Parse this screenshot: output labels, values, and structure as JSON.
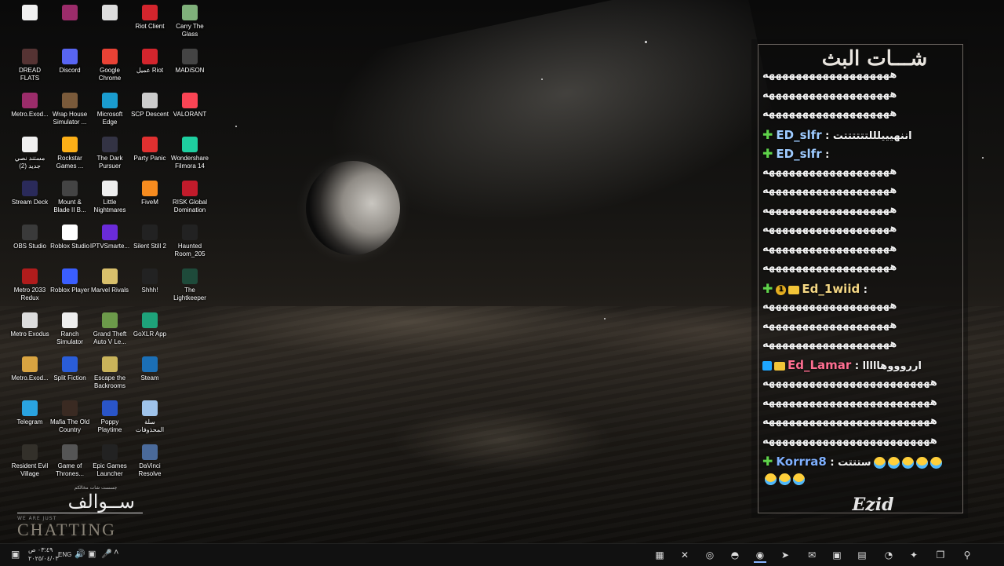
{
  "desktop_icons": [
    {
      "label": "",
      "icon": "text-file-icon",
      "color": "#f0f0f0"
    },
    {
      "label": "",
      "icon": "winrar-icon",
      "color": "#9b2c6a"
    },
    {
      "label": "",
      "icon": "cursor-app-icon",
      "color": "#dddddd"
    },
    {
      "label": "Riot Client",
      "icon": "riot-client-icon",
      "color": "#d3252d"
    },
    {
      "label": "Carry The Glass",
      "icon": "carry-glass-icon",
      "color": "#7fb07a"
    },
    {
      "label": "DREAD FLATS",
      "icon": "dread-flats-icon",
      "color": "#553333"
    },
    {
      "label": "Discord",
      "icon": "discord-icon",
      "color": "#5865f2"
    },
    {
      "label": "Google Chrome",
      "icon": "chrome-icon",
      "color": "#e94235"
    },
    {
      "label": "عميل Riot",
      "icon": "riot-client-icon",
      "color": "#d3252d"
    },
    {
      "label": "MADiSON",
      "icon": "madison-icon",
      "color": "#444444"
    },
    {
      "label": "Metro.Exod...",
      "icon": "winrar-icon",
      "color": "#9b2c6a"
    },
    {
      "label": "Wrap House Simulator ...",
      "icon": "wrap-house-icon",
      "color": "#7a5a3a"
    },
    {
      "label": "Microsoft Edge",
      "icon": "edge-icon",
      "color": "#1a9ccf"
    },
    {
      "label": "SCP Descent",
      "icon": "scp-icon",
      "color": "#cccccc"
    },
    {
      "label": "VALORANT",
      "icon": "valorant-icon",
      "color": "#fa4454"
    },
    {
      "label": "مستند نصي جديد (2)",
      "icon": "text-file-icon",
      "color": "#f0f0f0"
    },
    {
      "label": "Rockstar Games ...",
      "icon": "rockstar-icon",
      "color": "#fcaf17"
    },
    {
      "label": "The Dark Pursuer",
      "icon": "dark-pursuer-icon",
      "color": "#333344"
    },
    {
      "label": "Party Panic",
      "icon": "party-panic-icon",
      "color": "#e03030"
    },
    {
      "label": "Wondershare Filmora 14",
      "icon": "filmora-icon",
      "color": "#1ecfa0"
    },
    {
      "label": "Stream Deck",
      "icon": "stream-deck-icon",
      "color": "#2a2a5a"
    },
    {
      "label": "Mount & Blade II B...",
      "icon": "mount-blade-icon",
      "color": "#444444"
    },
    {
      "label": "Little Nightmares",
      "icon": "little-nightmares-icon",
      "color": "#eeeeee"
    },
    {
      "label": "FiveM",
      "icon": "fivem-icon",
      "color": "#f78c1f"
    },
    {
      "label": "RISK Global Domination",
      "icon": "risk-icon",
      "color": "#c21b2b"
    },
    {
      "label": "OBS Studio",
      "icon": "obs-icon",
      "color": "#3a3a3a"
    },
    {
      "label": "Roblox Studio",
      "icon": "roblox-studio-icon",
      "color": "#ffffff"
    },
    {
      "label": "IPTVSmarte...",
      "icon": "iptv-icon",
      "color": "#6a2bd9"
    },
    {
      "label": "Silent Still 2",
      "icon": "silent-still-icon",
      "color": "#222222"
    },
    {
      "label": "Haunted Room_205",
      "icon": "haunted-room-icon",
      "color": "#222222"
    },
    {
      "label": "Metro 2033 Redux",
      "icon": "metro-redux-icon",
      "color": "#b01c1c"
    },
    {
      "label": "Roblox Player",
      "icon": "roblox-player-icon",
      "color": "#3a5eff"
    },
    {
      "label": "Marvel Rivals",
      "icon": "marvel-rivals-icon",
      "color": "#d9c06b"
    },
    {
      "label": "Shhh!",
      "icon": "shhh-icon",
      "color": "#222222"
    },
    {
      "label": "The Lightkeeper",
      "icon": "lightkeeper-icon",
      "color": "#1e4a3a"
    },
    {
      "label": "Metro Exodus",
      "icon": "metro-exodus-icon",
      "color": "#dddddd"
    },
    {
      "label": "Ranch Simulator",
      "icon": "ranch-simulator-icon",
      "color": "#eeeeee"
    },
    {
      "label": "Grand Theft Auto V Le...",
      "icon": "gta-icon",
      "color": "#6c9a4a"
    },
    {
      "label": "GoXLR App",
      "icon": "goxlr-icon",
      "color": "#1ea37a"
    },
    {
      "label": "Metro.Exod...",
      "icon": "text-file-icon",
      "color": "#d9a441"
    },
    {
      "label": "Split Fiction",
      "icon": "split-fiction-icon",
      "color": "#2a5dd8"
    },
    {
      "label": "Escape the Backrooms",
      "icon": "backrooms-icon",
      "color": "#c9b35a"
    },
    {
      "label": "Steam",
      "icon": "steam-icon",
      "color": "#1b6fb6"
    },
    {
      "label": "Telegram",
      "icon": "telegram-icon",
      "color": "#2aa3e0"
    },
    {
      "label": "Mafia The Old Country",
      "icon": "mafia-icon",
      "color": "#3a2a22"
    },
    {
      "label": "Poppy Playtime",
      "icon": "poppy-icon",
      "color": "#2a55c8"
    },
    {
      "label": "سلة المحذوفات",
      "icon": "recycle-bin-icon",
      "color": "#9fc3ea"
    },
    {
      "label": "Resident Evil Village",
      "icon": "resident-evil-icon",
      "color": "#33302a"
    },
    {
      "label": "Game of Thrones...",
      "icon": "got-icon",
      "color": "#555555"
    },
    {
      "label": "Epic Games Launcher",
      "icon": "epic-games-icon",
      "color": "#222222"
    },
    {
      "label": "DaVinci Resolve",
      "icon": "davinci-icon",
      "color": "#4a6a9a"
    }
  ],
  "logo": {
    "small": "جسست شات مخالكم",
    "arabic": "ســوالف",
    "tagline": "WE ARE JUST",
    "chatting": "CHATTING"
  },
  "chat": {
    "title": "شـــات البث",
    "lines": [
      {
        "text": "هههههههههههههههههههه"
      },
      {
        "text": "هههههههههههههههههههه"
      },
      {
        "text": "هههههههههههههههههههه"
      },
      {
        "user": "ED_slfr",
        "sep": " : ",
        "text": "اننهيييلللتتتتتتت",
        "user_color": "#9ecbff",
        "badges": "plus"
      },
      {
        "user": "ED_slfr",
        "sep": " : ",
        "text": "",
        "user_color": "#9ecbff",
        "badges": "plus"
      },
      {
        "text": "هههههههههههههههههههه"
      },
      {
        "text": "هههههههههههههههههههه"
      },
      {
        "text": "هههههههههههههههههههه"
      },
      {
        "text": "هههههههههههههههههههه"
      },
      {
        "text": "هههههههههههههههههههه"
      },
      {
        "text": "هههههههههههههههههههه"
      },
      {
        "user": "Ed_1wiid",
        "sep": " : ",
        "text": "",
        "user_color": "#f4d784",
        "badges": "plus-1-crown"
      },
      {
        "text": "هههههههههههههههههههه"
      },
      {
        "text": "هههههههههههههههههههه"
      },
      {
        "text": "هههههههههههههههههههه"
      },
      {
        "user": "Ed_Lamar",
        "sep": " : ",
        "text": "ارروووهااااا",
        "user_color": "#ff6f91",
        "badges": "t-ezi-crown"
      },
      {
        "text": "هههههههههههههههههههههههههه"
      },
      {
        "text": "هههههههههههههههههههههههههه"
      },
      {
        "text": "هههههههههههههههههههههههههه"
      },
      {
        "text": "هههههههههههههههههههههههههه"
      },
      {
        "user": "Korrra8",
        "sep": " : ",
        "text": "ستتتت",
        "user_color": "#7fb0ff",
        "badges": "plus",
        "emoji_count": 5
      },
      {
        "text": "",
        "emoji_count": 3
      }
    ],
    "footer_logo": "Ezid"
  },
  "taskbar": {
    "notification_icon": "notification-icon",
    "time": "٠٣:٤٩ ص",
    "date": "٢٠٢٥/٠٤/٠٣",
    "lang": "ENG",
    "apps": [
      {
        "icon": "stream-deck-taskbar-icon"
      },
      {
        "icon": "xbox-taskbar-icon"
      },
      {
        "icon": "obs-taskbar-icon"
      },
      {
        "icon": "discord-taskbar-icon"
      },
      {
        "icon": "chrome-taskbar-icon",
        "active": true
      },
      {
        "icon": "telegram-taskbar-icon"
      },
      {
        "icon": "outlook-taskbar-icon"
      },
      {
        "icon": "store-taskbar-icon"
      },
      {
        "icon": "file-explorer-taskbar-icon"
      },
      {
        "icon": "edge-taskbar-icon"
      },
      {
        "icon": "copilot-taskbar-icon"
      },
      {
        "icon": "task-view-icon"
      },
      {
        "icon": "search-icon"
      }
    ]
  }
}
